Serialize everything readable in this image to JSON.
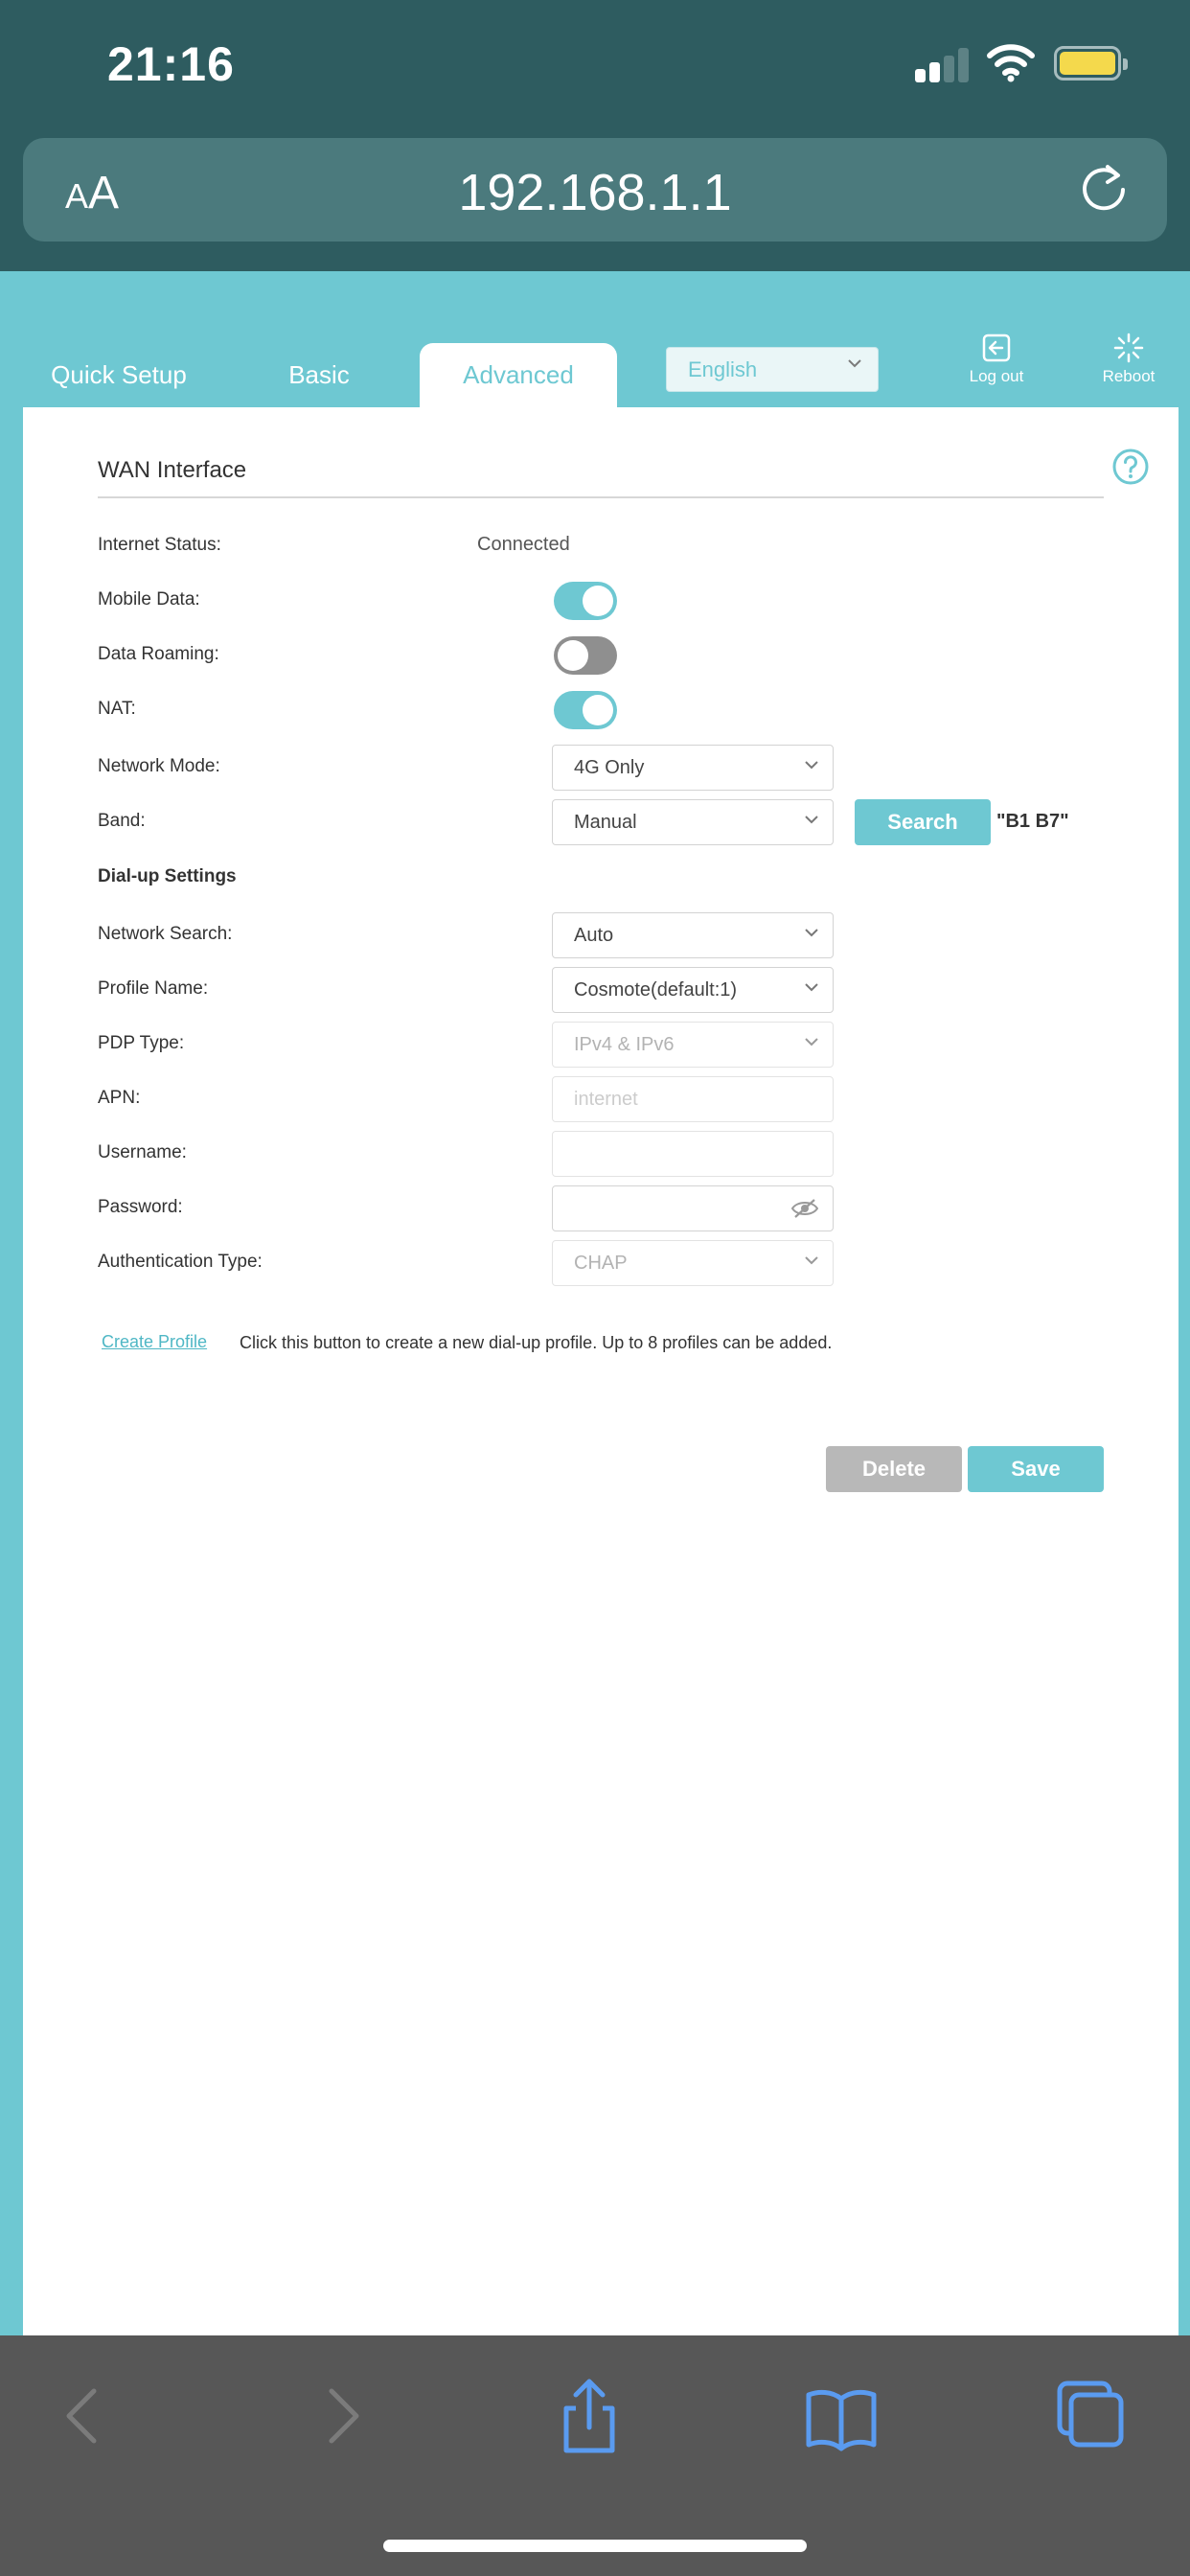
{
  "status_bar": {
    "time": "21:16"
  },
  "browser": {
    "text_size_label_small": "A",
    "text_size_label_large": "A",
    "url": "192.168.1.1"
  },
  "router_nav": {
    "tabs": [
      "Quick Setup",
      "Basic",
      "Advanced"
    ],
    "active_tab": "Advanced",
    "language": "English",
    "logout_label": "Log out",
    "reboot_label": "Reboot"
  },
  "wan": {
    "title": "WAN Interface",
    "internet_status_label": "Internet Status:",
    "internet_status_value": "Connected",
    "mobile_data_label": "Mobile Data:",
    "mobile_data_on": true,
    "data_roaming_label": "Data Roaming:",
    "data_roaming_on": false,
    "nat_label": "NAT:",
    "nat_on": true,
    "network_mode_label": "Network Mode:",
    "network_mode_value": "4G Only",
    "band_label": "Band:",
    "band_value": "Manual",
    "search_button": "Search",
    "band_note": "\"B1 B7\""
  },
  "dialup": {
    "heading": "Dial-up Settings",
    "network_search_label": "Network Search:",
    "network_search_value": "Auto",
    "profile_name_label": "Profile Name:",
    "profile_name_value": "Cosmote(default:1)",
    "pdp_type_label": "PDP Type:",
    "pdp_type_value": "IPv4 & IPv6",
    "apn_label": "APN:",
    "apn_placeholder": "internet",
    "username_label": "Username:",
    "username_value": "",
    "password_label": "Password:",
    "password_value": "",
    "auth_type_label": "Authentication Type:",
    "auth_type_value": "CHAP",
    "create_profile_link": "Create Profile",
    "create_profile_note": "Click this button to create a new dial-up profile. Up to 8 profiles can be added.",
    "delete_button": "Delete",
    "save_button": "Save"
  },
  "colors": {
    "accent": "#6ec8d2",
    "status_bar": "#2e5c60",
    "toolbar": "#575757"
  }
}
